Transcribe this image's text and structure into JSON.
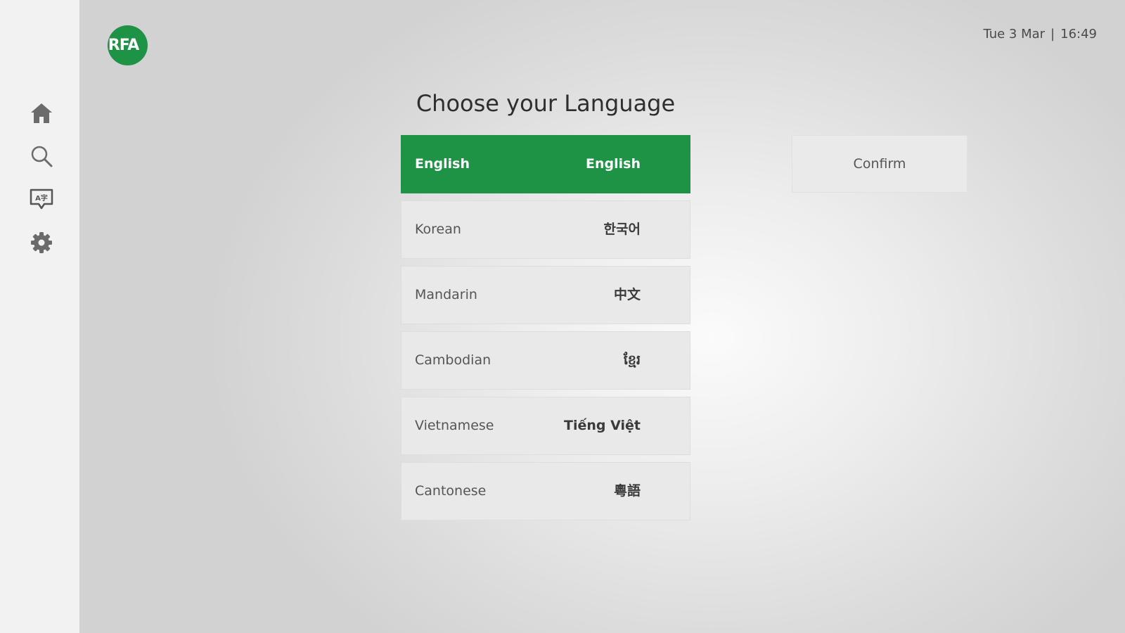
{
  "sidebar": {
    "items": [
      {
        "icon": "home-icon"
      },
      {
        "icon": "search-icon"
      },
      {
        "icon": "language-icon"
      },
      {
        "icon": "settings-gear-icon"
      }
    ]
  },
  "header": {
    "logo_text": "RFA",
    "date": "Tue 3 Mar",
    "separator": "|",
    "time": "16:49"
  },
  "main": {
    "title": "Choose your Language",
    "languages": [
      {
        "name": "English",
        "native": "English",
        "selected": true
      },
      {
        "name": "Korean",
        "native": "한국어",
        "selected": false
      },
      {
        "name": "Mandarin",
        "native": "中文",
        "selected": false
      },
      {
        "name": "Cambodian",
        "native": "ខ្មែរ",
        "selected": false
      },
      {
        "name": "Vietnamese",
        "native": "Tiếng Việt",
        "selected": false
      },
      {
        "name": "Cantonese",
        "native": "粵語",
        "selected": false
      }
    ],
    "confirm_label": "Confirm"
  },
  "colors": {
    "accent": "#1e9245",
    "sidebar_bg": "#f2f2f2",
    "item_bg": "#e9e9e9",
    "text_muted": "#555555"
  }
}
